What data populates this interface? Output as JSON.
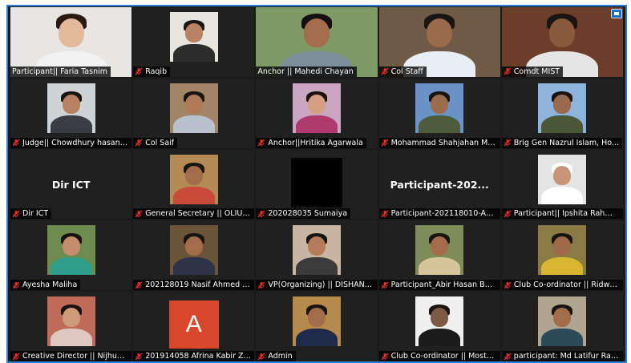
{
  "participants": [
    {
      "name": "Participant|| Faria Tasnim",
      "muted": false,
      "active": true,
      "mode": "full",
      "bg": "#e8e6e4",
      "skin": "#e2b99a",
      "hair": "#2a1a12",
      "cloth": "#f2f2f2"
    },
    {
      "name": "Raqib",
      "muted": true,
      "mode": "thumb",
      "bg": "#e7e5df",
      "skin": "#b98262",
      "hair": "#1b1411",
      "cloth": "#2c2c2c"
    },
    {
      "name": "Anchor || Mahedi Chayan",
      "muted": false,
      "mode": "full",
      "bg": "#7f9a66",
      "skin": "#a36c4b",
      "hair": "#141010",
      "cloth": "#7d8f9a"
    },
    {
      "name": "Col Staff",
      "muted": true,
      "mode": "full",
      "bg": "#6f5a46",
      "skin": "#9a6a4c",
      "hair": "#1b1411",
      "cloth": "#e9eef3"
    },
    {
      "name": "Comdt MIST",
      "muted": true,
      "mode": "full",
      "bg": "#6b3e2a",
      "skin": "#8a5a3e",
      "hair": "#1b1411",
      "cloth": "#e5e5e5"
    },
    {
      "name": "Judge|| Chowdhury hasan i...",
      "muted": true,
      "mode": "thumb",
      "bg": "#cfd3d6",
      "skin": "#b88262",
      "hair": "#1a1411",
      "cloth": "#3a3d44"
    },
    {
      "name": "Col Saif",
      "muted": true,
      "mode": "thumb",
      "bg": "#a08566",
      "skin": "#b07a58",
      "hair": "#1a1411",
      "cloth": "#b9c2cc"
    },
    {
      "name": "Anchor||Hritika Agarwala",
      "muted": true,
      "mode": "thumb",
      "bg": "#c9a7c0",
      "skin": "#d4a07f",
      "hair": "#1b1210",
      "cloth": "#b03a6e"
    },
    {
      "name": "Mohammad Shahjahan MA...",
      "muted": true,
      "mode": "thumb",
      "bg": "#6a94c9",
      "skin": "#9d6c4d",
      "hair": "#1a1411",
      "cloth": "#4d5c3b"
    },
    {
      "name": "Brig Gen Nazrul Islam, Ho...",
      "muted": true,
      "mode": "thumb",
      "bg": "#8eb3dc",
      "skin": "#9a6a4c",
      "hair": "#1a1411",
      "cloth": "#4a5838"
    },
    {
      "name": "Dir ICT",
      "muted": true,
      "mode": "text",
      "label": "Dir ICT"
    },
    {
      "name": "General Secretary || OLIULL...",
      "muted": true,
      "mode": "thumb",
      "bg": "#b58b55",
      "skin": "#a36c4b",
      "hair": "#1a1411",
      "cloth": "#c74a3b"
    },
    {
      "name": "202028035 Sumaiya",
      "muted": true,
      "mode": "black"
    },
    {
      "name": "Participant-202118010-Anik...",
      "muted": true,
      "mode": "text",
      "label": "Participant-202..."
    },
    {
      "name": "Participant|| Ipshita Rahma...",
      "muted": true,
      "mode": "thumb",
      "bg": "#e4e4e4",
      "skin": "#c99478",
      "hair": "#ffffff",
      "cloth": "#ffffff"
    },
    {
      "name": "Ayesha Maliha",
      "muted": true,
      "mode": "thumb",
      "bg": "#6e8c4e",
      "skin": "#c48d6c",
      "hair": "#1b1210",
      "cloth": "#2e9e8a"
    },
    {
      "name": "202128019 Nasif Ahmed C...",
      "muted": true,
      "mode": "thumb",
      "bg": "#6a5538",
      "skin": "#a36c4b",
      "hair": "#1a1411",
      "cloth": "#2f3347"
    },
    {
      "name": "VP(Organizing) || DISHAN ...",
      "muted": true,
      "mode": "thumb",
      "bg": "#c7b6a3",
      "skin": "#b47c5a",
      "hair": "#1a1411",
      "cloth": "#3b3b3b"
    },
    {
      "name": "Participant_Abir Hasan Bhui...",
      "muted": true,
      "mode": "thumb",
      "bg": "#7d8c58",
      "skin": "#a36c4b",
      "hair": "#1a1411",
      "cloth": "#d6c49a"
    },
    {
      "name": "Club Co-ordinator || Ridwa...",
      "muted": true,
      "mode": "thumb",
      "bg": "#8a7a44",
      "skin": "#9e6a48",
      "hair": "#1a1411",
      "cloth": "#d8b632"
    },
    {
      "name": "Creative Director || Nijhum ...",
      "muted": true,
      "mode": "thumb",
      "bg": "#c06a5a",
      "skin": "#d09b7a",
      "hair": "#1b1210",
      "cloth": "#e0c7c1"
    },
    {
      "name": "201914058 Afrina Kabir Zinia",
      "muted": true,
      "mode": "avatar",
      "letter": "A"
    },
    {
      "name": "Admin",
      "muted": true,
      "mode": "thumb",
      "bg": "#b58a4a",
      "skin": "#a36c4b",
      "hair": "#1a1411",
      "cloth": "#1f2a4a"
    },
    {
      "name": "Club Co-ordinator || Mosto...",
      "muted": true,
      "mode": "thumb",
      "bg": "#f0f0f0",
      "skin": "#7e5a44",
      "hair": "#1a1411",
      "cloth": "#1b1b1b"
    },
    {
      "name": "participant: Md Latifur Rah...",
      "muted": true,
      "mode": "thumb",
      "bg": "#b0a58e",
      "skin": "#a36c4b",
      "hair": "#1a1411",
      "cloth": "#2b4a5a"
    }
  ],
  "icons": {
    "corner": "screen-share-icon",
    "mute": "mic-muted-icon"
  },
  "colors": {
    "mute_red": "#e0302b",
    "active_border": "#f0d000",
    "frame_border": "#2a7fd4"
  }
}
